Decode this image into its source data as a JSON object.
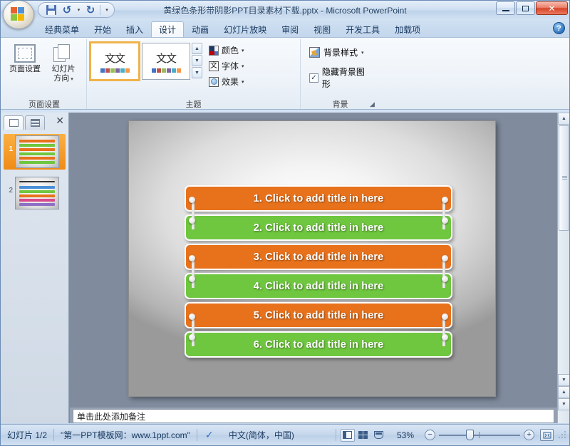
{
  "window": {
    "title": "黄绿色条形带阴影PPT目录素材下载.pptx - Microsoft PowerPoint",
    "minimize_label": "最小化",
    "restore_label": "还原",
    "close_label": "✕"
  },
  "quick_access": {
    "office_button": "office-orb",
    "items": [
      {
        "name": "save",
        "icon": "floppy-disk-icon",
        "label": "保存"
      },
      {
        "name": "undo",
        "icon": "undo-arrow-icon",
        "label": "撤消",
        "glyph": "↺"
      },
      {
        "name": "redo",
        "icon": "redo-arrow-icon",
        "label": "恢复",
        "glyph": "↻"
      }
    ],
    "customize_glyph": "▾"
  },
  "ribbon": {
    "tabs": [
      {
        "label": "经典菜单",
        "active": false
      },
      {
        "label": "开始",
        "active": false
      },
      {
        "label": "插入",
        "active": false
      },
      {
        "label": "设计",
        "active": true
      },
      {
        "label": "动画",
        "active": false
      },
      {
        "label": "幻灯片放映",
        "active": false
      },
      {
        "label": "审阅",
        "active": false
      },
      {
        "label": "视图",
        "active": false
      },
      {
        "label": "开发工具",
        "active": false
      },
      {
        "label": "加载项",
        "active": false
      }
    ],
    "help_glyph": "?",
    "groups": {
      "page_setup": {
        "label": "页面设置",
        "buttons": [
          {
            "label": "页面设置",
            "icon": "page-setup-icon"
          },
          {
            "label": "幻灯片\n方向",
            "label_line1": "幻灯片",
            "label_line2": "方向",
            "icon": "slide-orientation-icon",
            "caret": "▾"
          }
        ]
      },
      "theme": {
        "label": "主题",
        "thumbnails": [
          {
            "text": "文文",
            "selected": true,
            "swatches": [
              "#4472c4",
              "#c0504d",
              "#9bbb59",
              "#8064a2",
              "#4bacc6",
              "#f79646"
            ]
          },
          {
            "text": "文文",
            "selected": false,
            "swatches": [
              "#4472c4",
              "#c0504d",
              "#9bbb59",
              "#8064a2",
              "#4bacc6",
              "#f79646"
            ]
          }
        ],
        "gallery_scroll": {
          "up": "▲",
          "down": "▼",
          "more": "▼"
        },
        "options": [
          {
            "label": "颜色",
            "icon": "theme-colors-icon",
            "caret": "▾"
          },
          {
            "label": "字体",
            "icon": "theme-fonts-icon",
            "caret": "▾",
            "glyph": "文"
          },
          {
            "label": "效果",
            "icon": "theme-effects-icon",
            "caret": "▾"
          }
        ]
      },
      "background": {
        "label": "背景",
        "style_button": {
          "label": "背景样式",
          "icon": "background-styles-icon",
          "caret": "▾"
        },
        "checkbox": {
          "label": "隐藏背景图形",
          "checked": true,
          "check_glyph": "✓"
        },
        "dialog_launcher": "⁋"
      }
    }
  },
  "slide_panel": {
    "tabs": [
      {
        "name": "slides",
        "label": "幻灯片",
        "active": true
      },
      {
        "name": "outline",
        "label": "大纲",
        "active": false
      }
    ],
    "close_glyph": "✕",
    "slides": [
      {
        "number": "1",
        "selected": true,
        "bars": [
          "#e8721c",
          "#6fc63f",
          "#e8721c",
          "#6fc63f",
          "#e8721c",
          "#6fc63f"
        ]
      },
      {
        "number": "2",
        "selected": false,
        "bars": [
          "#4a90d9",
          "#6fc63f",
          "#e8721c",
          "#d94a8c",
          "#8e6fc6"
        ]
      }
    ]
  },
  "slide": {
    "background_note": "radial white to gray gradient",
    "colors": {
      "orange": "#e8721c",
      "green": "#6fc63f"
    },
    "bars": [
      {
        "text": "1. Click to add title in here",
        "color": "#e8721c"
      },
      {
        "text": "2. Click to add title in here",
        "color": "#6fc63f"
      },
      {
        "text": "3. Click to add title in here",
        "color": "#e8721c"
      },
      {
        "text": "4. Click to add title in here",
        "color": "#6fc63f"
      },
      {
        "text": "5. Click to add title in here",
        "color": "#e8721c"
      },
      {
        "text": "6. Click to add title in here",
        "color": "#6fc63f"
      }
    ]
  },
  "notes": {
    "placeholder": "单击此处添加备注"
  },
  "scrollbar": {
    "up_glyph": "▲",
    "down_glyph": "▼",
    "prev_slide_glyph": "▲",
    "next_slide_glyph": "▼"
  },
  "status_bar": {
    "slide_counter": "幻灯片 1/2",
    "theme_name": "\"第一PPT模板网：www.1ppt.com\"",
    "language": "中文(简体，中国)",
    "spell_check_icon": "spell-check-icon",
    "views": [
      {
        "name": "normal",
        "label": "普通视图",
        "active": true
      },
      {
        "name": "slide-sorter",
        "label": "幻灯片浏览",
        "active": false
      },
      {
        "name": "reading",
        "label": "阅读视图",
        "active": false
      }
    ],
    "zoom_level": "53%",
    "zoom_out_glyph": "−",
    "zoom_in_glyph": "+",
    "fit_window_label": "使幻灯片适应当前窗口"
  }
}
